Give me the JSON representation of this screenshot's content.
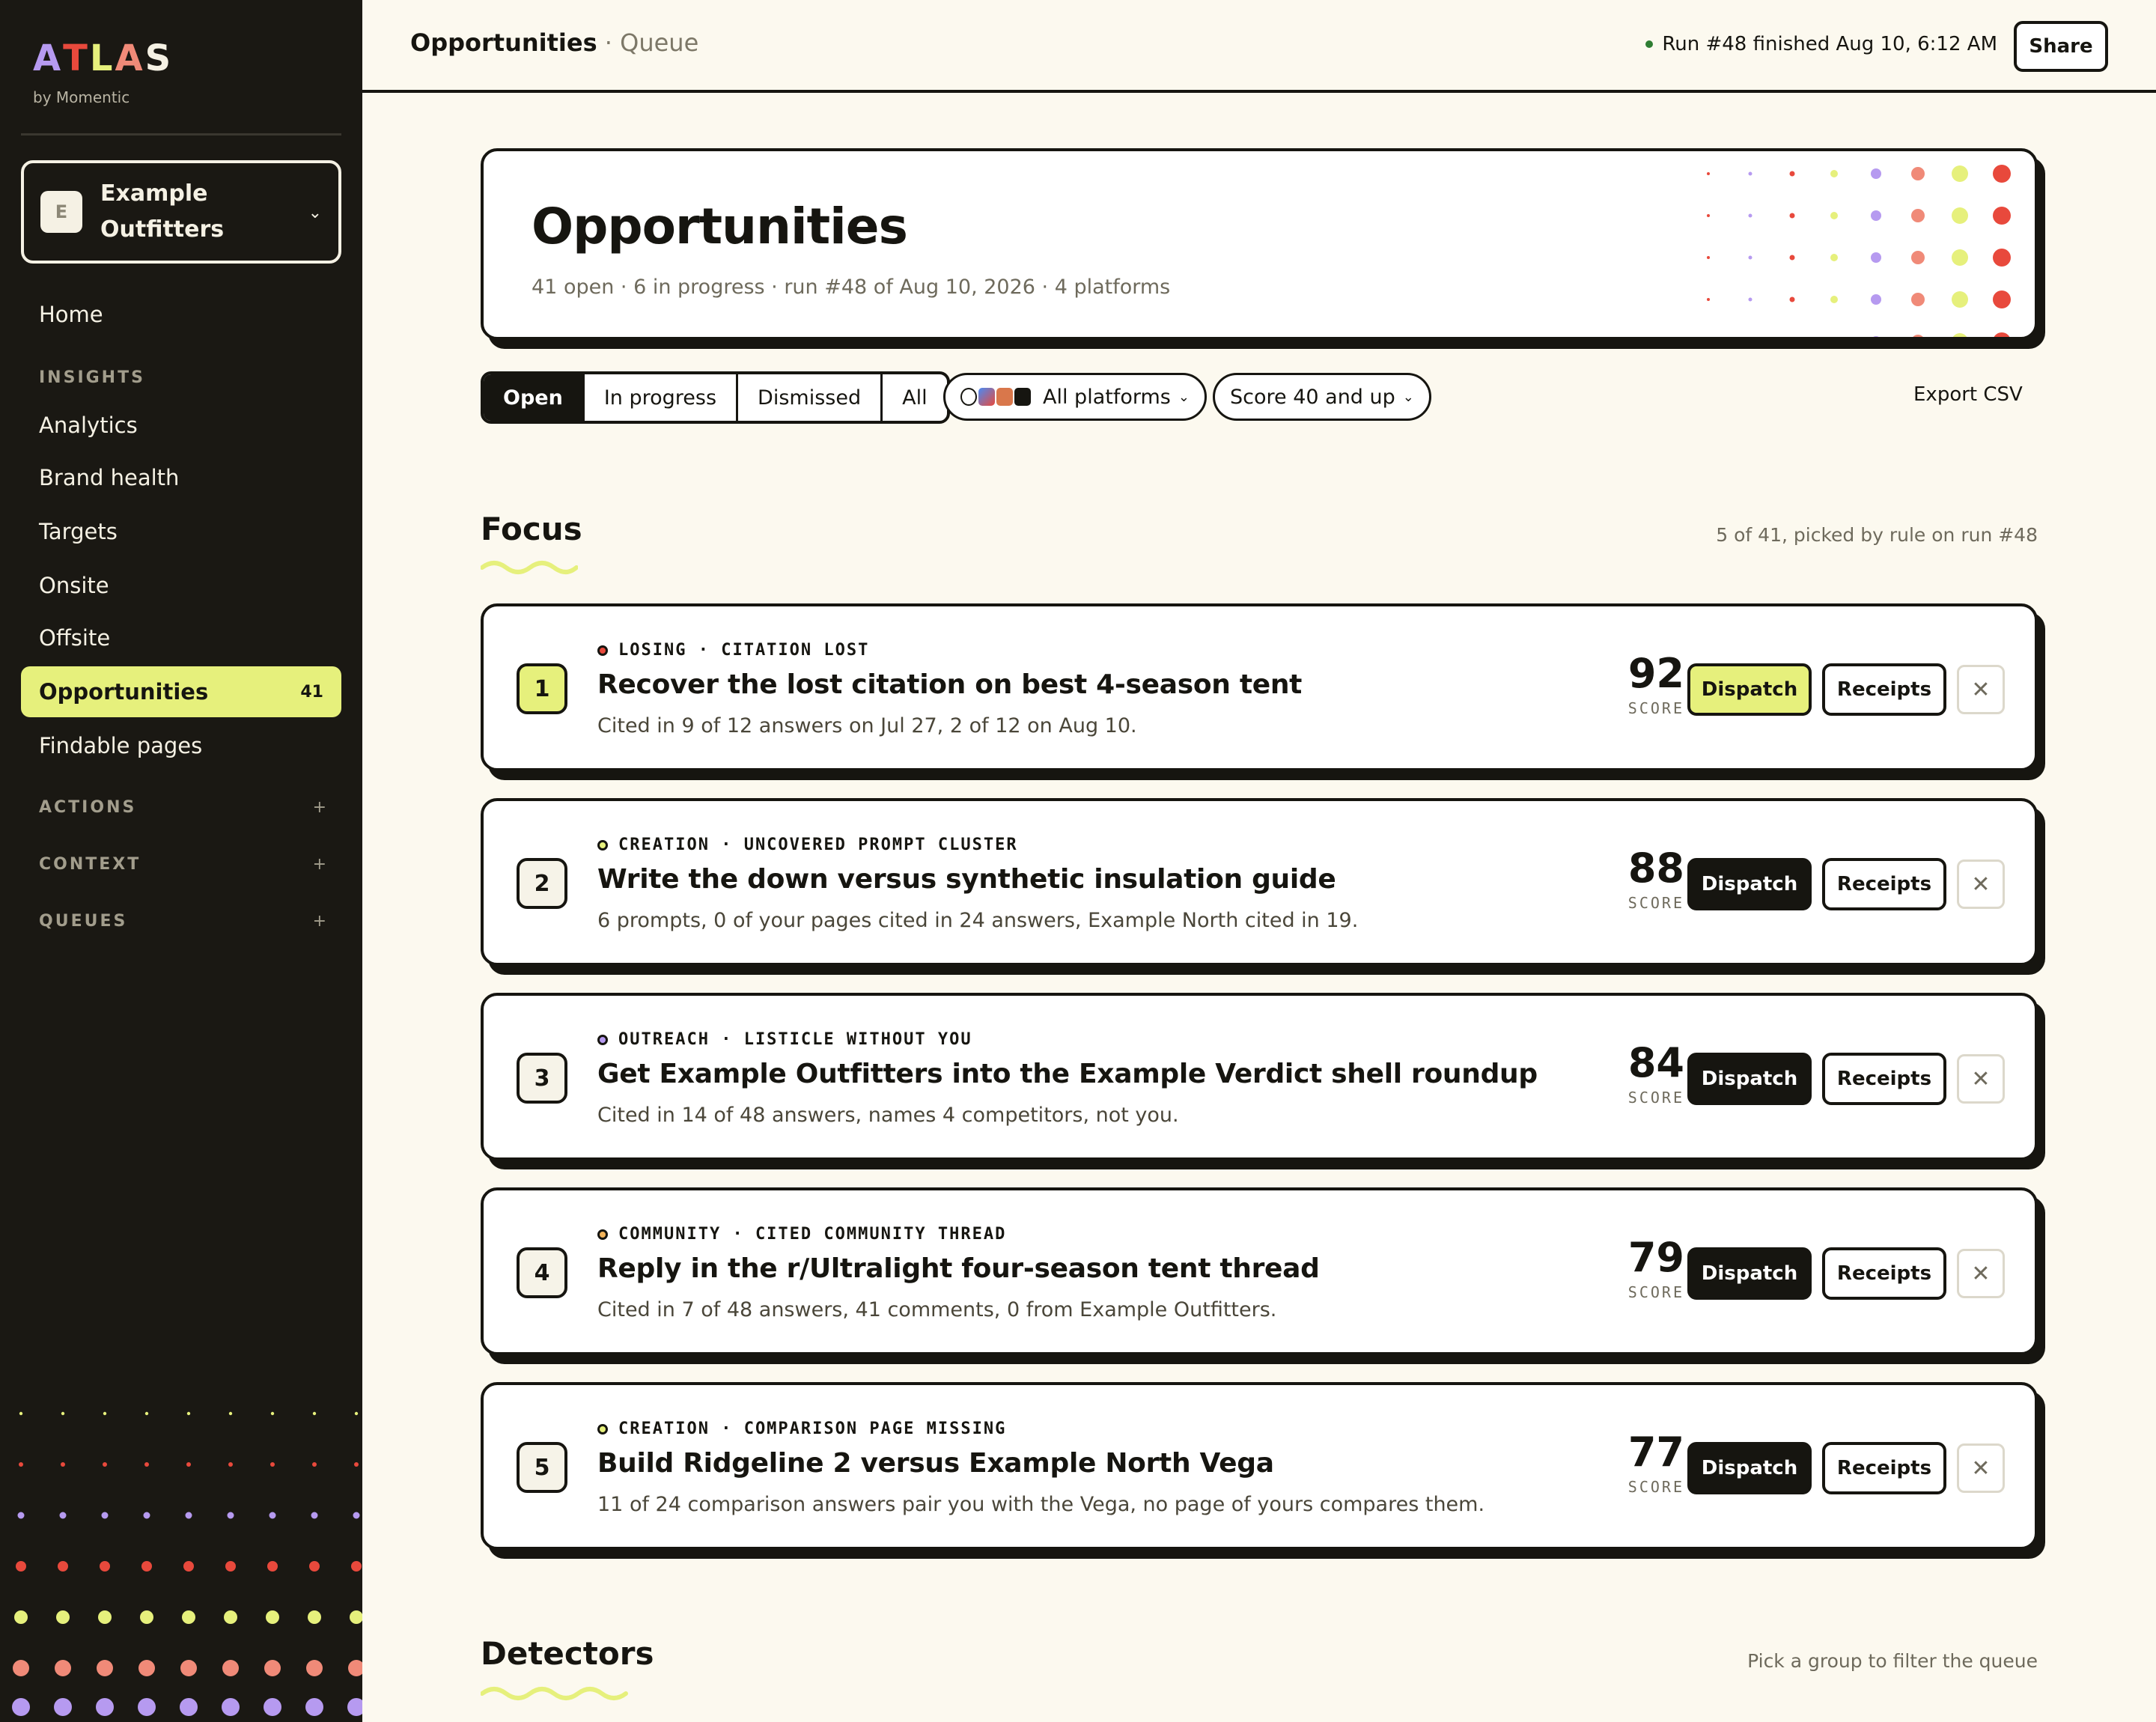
{
  "brand": {
    "logo_letters": [
      "A",
      "T",
      "L",
      "A",
      "S"
    ],
    "logo_colors": [
      "#b69af0",
      "#e8493c",
      "#e6f07c",
      "#f08a78",
      "#f5f1e4"
    ],
    "byline": "by Momentic",
    "accent": "#e6f07c"
  },
  "org": {
    "initial": "E",
    "name": "Example Outfitters",
    "chevron": "⌄"
  },
  "nav": {
    "home": "Home",
    "insights_label": "INSIGHTS",
    "items": [
      {
        "label": "Analytics"
      },
      {
        "label": "Brand health"
      },
      {
        "label": "Targets"
      },
      {
        "label": "Onsite"
      },
      {
        "label": "Offsite"
      },
      {
        "label": "Opportunities",
        "count": "41",
        "active": true
      },
      {
        "label": "Findable pages"
      }
    ],
    "sections": [
      {
        "label": "ACTIONS",
        "icon": "+"
      },
      {
        "label": "CONTEXT",
        "icon": "+"
      },
      {
        "label": "QUEUES",
        "icon": "+"
      }
    ]
  },
  "topbar": {
    "crumb_main": "Opportunities",
    "crumb_sep": " · ",
    "crumb_sub": "Queue",
    "run_status": "Run #48 finished Aug 10, 6:12 AM",
    "share": "Share"
  },
  "hero": {
    "title": "Opportunities",
    "subtitle": "41 open · 6 in progress · run #48 of Aug 10, 2026 · 4 platforms"
  },
  "filters": {
    "tabs": [
      "Open",
      "In progress",
      "Dismissed",
      "All"
    ],
    "selected_tab": "Open",
    "platforms": "All platforms",
    "score": "Score 40 and up",
    "chevron": "⌄",
    "export": "Export CSV"
  },
  "focus": {
    "title": "Focus",
    "note": "5 of 41, picked by rule on run #48",
    "cards": [
      {
        "rank": "1",
        "kicker": "LOSING · CITATION LOST",
        "dot": "#e8493c",
        "title": "Recover the lost citation on best 4-season tent",
        "desc": "Cited in 9 of 12 answers on Jul 27, 2 of 12 on Aug 10.",
        "score": "92",
        "score_label": "SCORE",
        "dispatch": "Dispatch",
        "receipts": "Receipts",
        "highlight": true
      },
      {
        "rank": "2",
        "kicker": "CREATION · UNCOVERED PROMPT CLUSTER",
        "dot": "#e6f07c",
        "title": "Write the down versus synthetic insulation guide",
        "desc": "6 prompts, 0 of your pages cited in 24 answers, Example North cited in 19.",
        "score": "88",
        "score_label": "SCORE",
        "dispatch": "Dispatch",
        "receipts": "Receipts",
        "highlight": false
      },
      {
        "rank": "3",
        "kicker": "OUTREACH · LISTICLE WITHOUT YOU",
        "dot": "#b69af0",
        "title": "Get Example Outfitters into the Example Verdict shell roundup",
        "desc": "Cited in 14 of 48 answers, names 4 competitors, not you.",
        "score": "84",
        "score_label": "SCORE",
        "dispatch": "Dispatch",
        "receipts": "Receipts",
        "highlight": false
      },
      {
        "rank": "4",
        "kicker": "COMMUNITY · CITED COMMUNITY THREAD",
        "dot": "#f3b45a",
        "title": "Reply in the r/Ultralight four-season tent thread",
        "desc": "Cited in 7 of 48 answers, 41 comments, 0 from Example Outfitters.",
        "score": "79",
        "score_label": "SCORE",
        "dispatch": "Dispatch",
        "receipts": "Receipts",
        "highlight": false
      },
      {
        "rank": "5",
        "kicker": "CREATION · COMPARISON PAGE MISSING",
        "dot": "#e6f07c",
        "title": "Build Ridgeline 2 versus Example North Vega",
        "desc": "11 of 24 comparison answers pair you with the Vega, no page of yours compares them.",
        "score": "77",
        "score_label": "SCORE",
        "dispatch": "Dispatch",
        "receipts": "Receipts",
        "highlight": false
      }
    ]
  },
  "detectors": {
    "title": "Detectors",
    "note": "Pick a group to filter the queue"
  },
  "icons": {
    "close": "close-icon",
    "org_chevron": "chevron-down-icon",
    "status_dot": "status-dot-icon",
    "platform_icons": [
      "openai-icon",
      "gemini-icon",
      "claude-icon",
      "perplexity-icon"
    ]
  },
  "close_glyph": "✕"
}
